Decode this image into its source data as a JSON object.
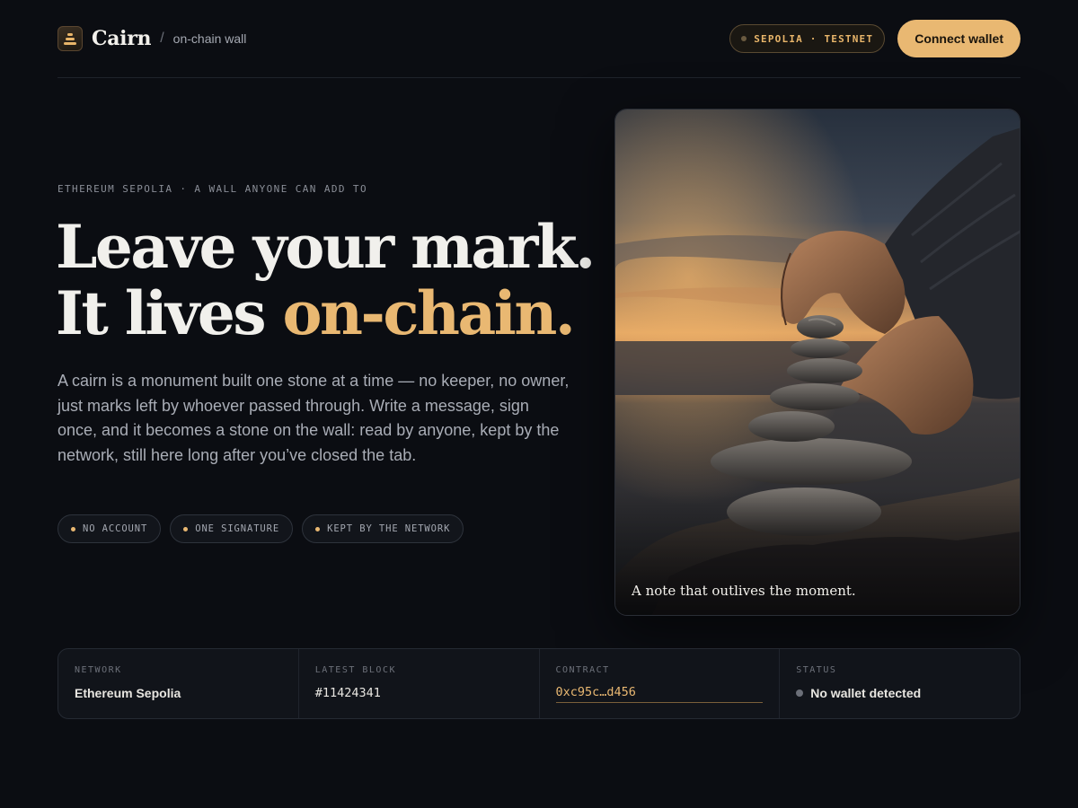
{
  "header": {
    "brand_name": "Cairn",
    "brand_separator": "/",
    "brand_subtitle": "on-chain wall",
    "network_pill": "SEPOLIA · TESTNET",
    "connect_label": "Connect wallet"
  },
  "hero": {
    "eyebrow": "ETHEREUM SEPOLIA · A WALL ANYONE CAN ADD TO",
    "headline_line1": "Leave your mark.",
    "headline_line2_prefix": "It lives ",
    "headline_line2_accent": "on-chain.",
    "lede": "A cairn is a monument built one stone at a time — no keeper, no owner, just marks left by whoever passed through. Write a message, sign once, and it becomes a stone on the wall: read by anyone, kept by the network, still here long after you’ve closed the tab.",
    "chips": [
      "NO ACCOUNT",
      "ONE SIGNATURE",
      "KEPT BY THE NETWORK"
    ]
  },
  "photo": {
    "icon": "stacked-stones-photo",
    "caption": "A note that outlives the moment."
  },
  "stats": {
    "network_label": "NETWORK",
    "network_value": "Ethereum Sepolia",
    "block_label": "LATEST BLOCK",
    "block_value": "#11424341",
    "contract_label": "CONTRACT",
    "contract_value": "0xc95c…d456",
    "status_label": "STATUS",
    "status_value": "No wallet detected"
  },
  "colors": {
    "background": "#0b0d12",
    "accent": "#e9b872",
    "text": "#f1f0ec",
    "muted": "#a9adb6"
  }
}
